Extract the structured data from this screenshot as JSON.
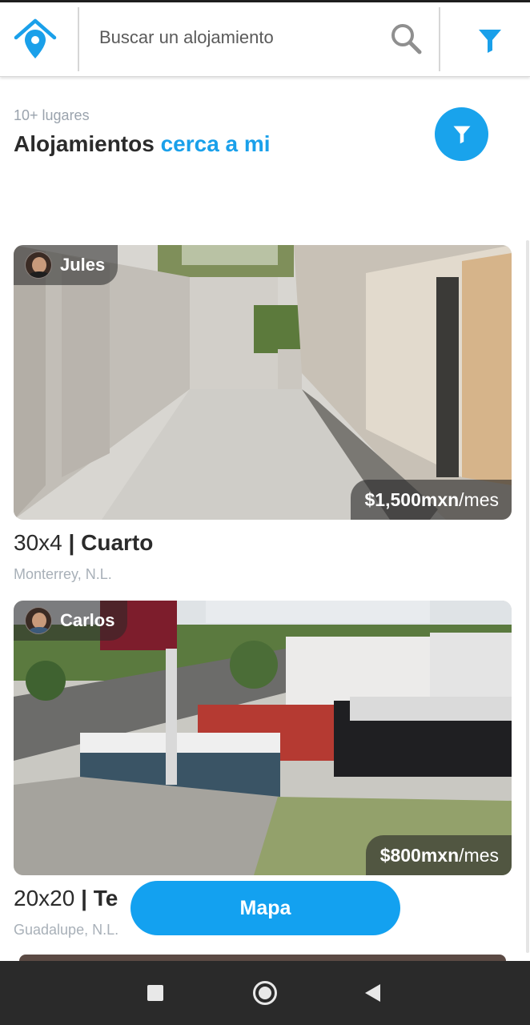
{
  "search": {
    "placeholder": "Buscar un alojamiento"
  },
  "header": {
    "count_text": "10+ lugares",
    "title_main": "Alojamientos",
    "title_accent": "cerca a mi"
  },
  "listings": [
    {
      "host": "Jules",
      "price_amount": "$1,500mxn",
      "price_unit": "/mes",
      "size": "30x4",
      "separator": "|",
      "type": "Cuarto",
      "location": "Monterrey, N.L."
    },
    {
      "host": "Carlos",
      "price_amount": "$800mxn",
      "price_unit": "/mes",
      "size": "20x20",
      "separator": "|",
      "type": "Te",
      "location": "Guadalupe, N.L."
    }
  ],
  "map_button": {
    "label": "Mapa"
  },
  "colors": {
    "accent": "#19a3ec",
    "title": "#2b2b2b",
    "muted": "#9aa3ad"
  },
  "icons": [
    "location-pin-icon",
    "search-icon",
    "filter-icon",
    "square-recent-icon",
    "circle-home-icon",
    "triangle-back-icon"
  ]
}
